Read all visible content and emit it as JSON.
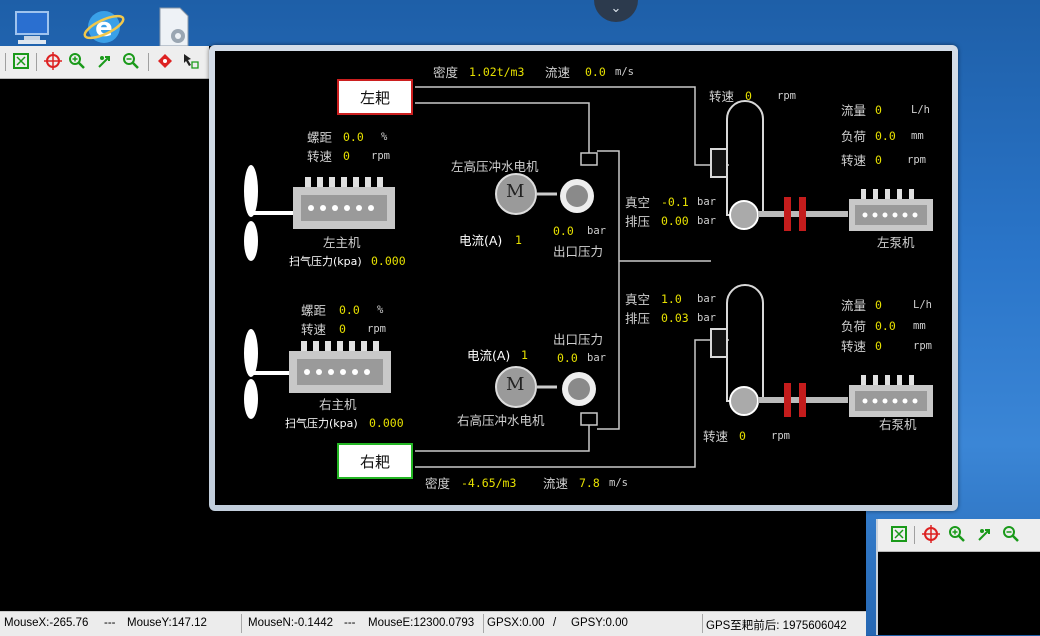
{
  "status_bar": {
    "mouse_x": "MouseX:-265.76",
    "sep1": "---",
    "mouse_y": "MouseY:147.12",
    "mouse_n": "MouseN:-0.1442",
    "sep2": "---",
    "mouse_e": "MouseE:12300.0793",
    "gps_x": "GPSX:0.00",
    "slash": "/",
    "gps_y": "GPSY:0.00",
    "gps_dist": "GPS至耙前后: 1975606042"
  },
  "panel": {
    "top_flow": {
      "density_label": "密度",
      "density_value": "1.02t/m3",
      "speed_label": "流速",
      "speed_value": "0.0",
      "speed_unit": "m/s"
    },
    "bottom_flow": {
      "density_label": "密度",
      "density_value": "-4.65/m3",
      "speed_label": "流速",
      "speed_value": "7.8",
      "speed_unit": "m/s"
    },
    "left_rake": "左耙",
    "right_rake": "右耙",
    "left_main_engine": {
      "pitch_label": "螺距",
      "pitch_value": "0.0",
      "pitch_unit": "%",
      "rpm_label": "转速",
      "rpm_value": "0",
      "rpm_unit": "rpm",
      "name": "左主机",
      "scav_label": "扫气压力(kpa)",
      "scav_value": "0.000"
    },
    "right_main_engine": {
      "pitch_label": "螺距",
      "pitch_value": "0.0",
      "pitch_unit": "%",
      "rpm_label": "转速",
      "rpm_value": "0",
      "rpm_unit": "rpm",
      "name": "右主机",
      "scav_label": "扫气压力(kpa)",
      "scav_value": "0.000"
    },
    "left_jet_motor": {
      "name": "左高压冲水电机",
      "current_label": "电流(A)",
      "current_value": "1",
      "outlet_value": "0.0",
      "outlet_unit": "bar",
      "outlet_label": "出口压力"
    },
    "right_jet_motor": {
      "name": "右高压冲水电机",
      "current_label": "电流(A)",
      "current_value": "1",
      "outlet_value": "0.0",
      "outlet_unit": "bar",
      "outlet_label": "出口压力"
    },
    "left_dredge_pump": {
      "rpm_label": "转速",
      "rpm_value": "0",
      "rpm_unit": "rpm",
      "vacuum_label": "真空",
      "vacuum_value": "-0.1",
      "vacuum_unit": "bar",
      "discharge_label": "排压",
      "discharge_value": "0.00",
      "discharge_unit": "bar"
    },
    "right_dredge_pump": {
      "rpm_label": "转速",
      "rpm_value": "0",
      "rpm_unit": "rpm",
      "vacuum_label": "真空",
      "vacuum_value": "1.0",
      "vacuum_unit": "bar",
      "discharge_label": "排压",
      "discharge_value": "0.03",
      "discharge_unit": "bar"
    },
    "left_pump_engine": {
      "flow_label": "流量",
      "flow_value": "0",
      "flow_unit": "L/h",
      "load_label": "负荷",
      "load_value": "0.0",
      "load_unit": "mm",
      "rpm_label": "转速",
      "rpm_value": "0",
      "rpm_unit": "rpm",
      "name": "左泵机"
    },
    "right_pump_engine": {
      "flow_label": "流量",
      "flow_value": "0",
      "flow_unit": "L/h",
      "load_label": "负荷",
      "load_value": "0.0",
      "load_unit": "mm",
      "rpm_label": "转速",
      "rpm_value": "0",
      "rpm_unit": "rpm",
      "name": "右泵机"
    },
    "motor_symbol": "M"
  },
  "colors": {
    "value": "#e6e000",
    "left_rake_border": "#cc1f1f",
    "right_rake_border": "#23b523",
    "coupling": "#c41c1c"
  },
  "icons": [
    "computer-icon",
    "internet-explorer-icon",
    "settings-file-icon",
    "chevron-down-icon",
    "fit-extent-icon",
    "crosshair-icon",
    "zoom-in-icon",
    "pan-icon",
    "zoom-out-icon",
    "target-icon",
    "select-arrow-icon"
  ]
}
